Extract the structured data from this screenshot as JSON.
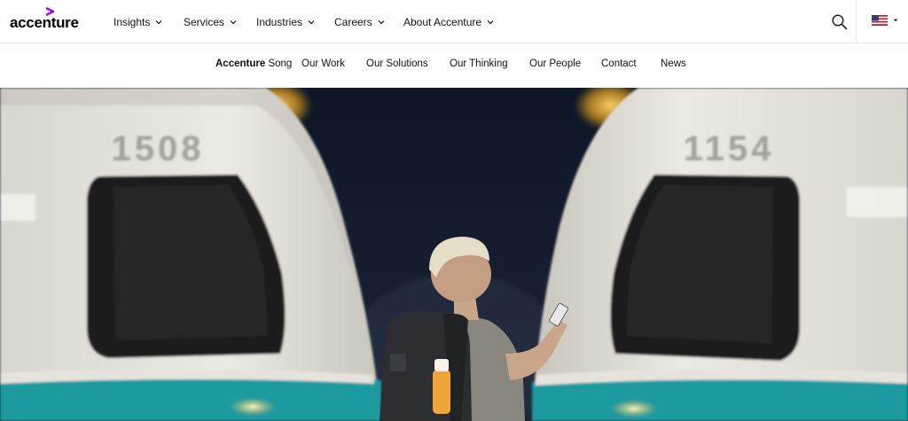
{
  "header": {
    "logo_text": "accenture",
    "nav": [
      {
        "label": "Insights"
      },
      {
        "label": "Services"
      },
      {
        "label": "Industries"
      },
      {
        "label": "Careers"
      },
      {
        "label": "About Accenture"
      }
    ],
    "search_icon": "search-icon",
    "locale_flag": "us-flag-icon"
  },
  "subnav": {
    "brand_bold": "Accenture",
    "brand_rest": " Song",
    "items": [
      {
        "label": "Our Work"
      },
      {
        "label": "Our Solutions"
      },
      {
        "label": "Our Thinking"
      },
      {
        "label": "Our People"
      },
      {
        "label": "Contact"
      },
      {
        "label": "News"
      }
    ]
  },
  "hero": {
    "train_left_number": "1508",
    "train_right_number": "1154"
  },
  "colors": {
    "accent": "#a100ff",
    "train_teal": "#1f9aa0",
    "train_white": "#e9e7e2",
    "night": "#0f1a2a"
  }
}
